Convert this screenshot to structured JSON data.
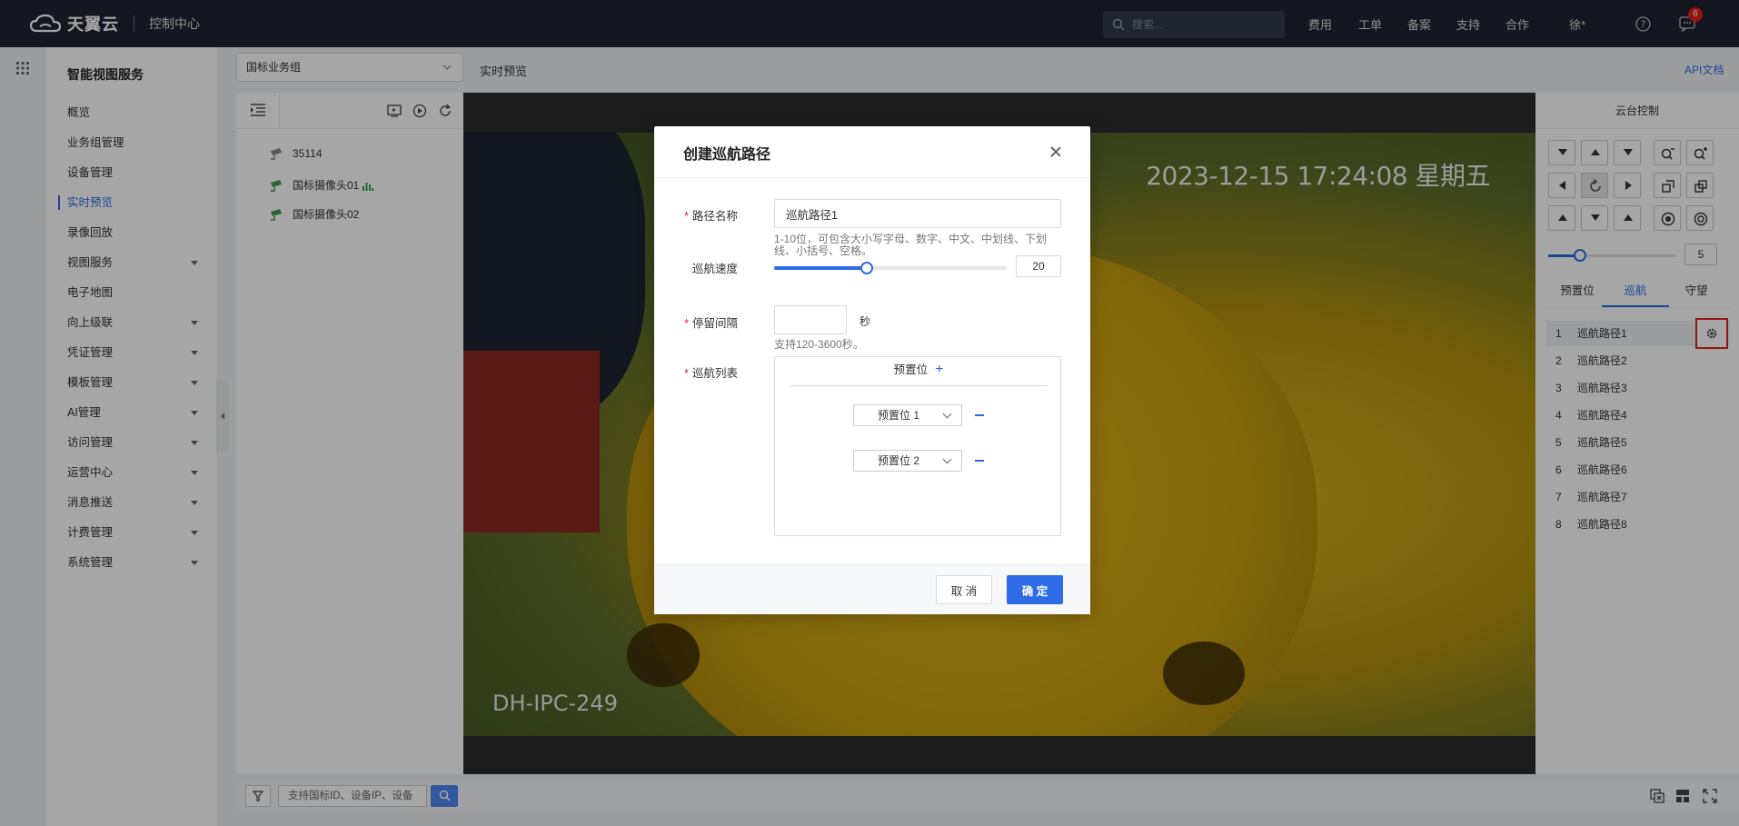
{
  "topbar": {
    "brand": "天翼云",
    "console": "控制中心",
    "search_placeholder": "搜索...",
    "nav": [
      "费用",
      "工单",
      "备案",
      "支持",
      "合作"
    ],
    "user": "徐*",
    "notification_count": "6"
  },
  "sidebar": {
    "title": "智能视图服务",
    "items": [
      {
        "label": "概览",
        "has_arrow": false
      },
      {
        "label": "业务组管理",
        "has_arrow": false
      },
      {
        "label": "设备管理",
        "has_arrow": false
      },
      {
        "label": "实时预览",
        "has_arrow": false,
        "active": true
      },
      {
        "label": "录像回放",
        "has_arrow": false
      },
      {
        "label": "视图服务",
        "has_arrow": true
      },
      {
        "label": "电子地图",
        "has_arrow": false
      },
      {
        "label": "向上级联",
        "has_arrow": true
      },
      {
        "label": "凭证管理",
        "has_arrow": true
      },
      {
        "label": "模板管理",
        "has_arrow": true
      },
      {
        "label": "AI管理",
        "has_arrow": true
      },
      {
        "label": "访问管理",
        "has_arrow": true
      },
      {
        "label": "运营中心",
        "has_arrow": true
      },
      {
        "label": "消息推送",
        "has_arrow": true
      },
      {
        "label": "计费管理",
        "has_arrow": true
      },
      {
        "label": "系统管理",
        "has_arrow": true
      }
    ]
  },
  "main": {
    "group_select": "国标业务组",
    "breadcrumb": "实时预览",
    "api_doc": "API文档"
  },
  "tree": {
    "items": [
      {
        "label": "35114",
        "online": false
      },
      {
        "label": "国标摄像头01",
        "online": true,
        "playing": true
      },
      {
        "label": "国标摄像头02",
        "online": true
      }
    ]
  },
  "video": {
    "osd_time": "2023-12-15 17:24:08 星期五",
    "osd_camera": "DH-IPC-249"
  },
  "ptz": {
    "title": "云台控制",
    "speed": "5",
    "speed_fraction": 0.25,
    "tabs": [
      "预置位",
      "巡航",
      "守望"
    ],
    "active_tab": 1,
    "routes": [
      {
        "num": "1",
        "label": "巡航路径1"
      },
      {
        "num": "2",
        "label": "巡航路径2"
      },
      {
        "num": "3",
        "label": "巡航路径3"
      },
      {
        "num": "4",
        "label": "巡航路径4"
      },
      {
        "num": "5",
        "label": "巡航路径5"
      },
      {
        "num": "6",
        "label": "巡航路径6"
      },
      {
        "num": "7",
        "label": "巡航路径7"
      },
      {
        "num": "8",
        "label": "巡航路径8"
      }
    ]
  },
  "bottom": {
    "search_placeholder": "支持国标ID、设备IP、设备"
  },
  "dialog": {
    "title": "创建巡航路径",
    "path_name_label": "路径名称",
    "path_name_value": "巡航路径1",
    "path_name_hint": "1-10位，可包含大小写字母、数字、中文、中划线、下划线、小括号、空格。",
    "speed_label": "巡航速度",
    "speed_value": "20",
    "speed_fraction": 0.4,
    "dwell_label": "停留间隔",
    "dwell_value": "",
    "dwell_unit": "秒",
    "dwell_hint": "支持120-3600秒。",
    "cruise_label": "巡航列表",
    "cruise_header": "预置位",
    "presets": [
      "预置位 1",
      "预置位 2"
    ],
    "cancel": "取 消",
    "ok": "确 定"
  }
}
